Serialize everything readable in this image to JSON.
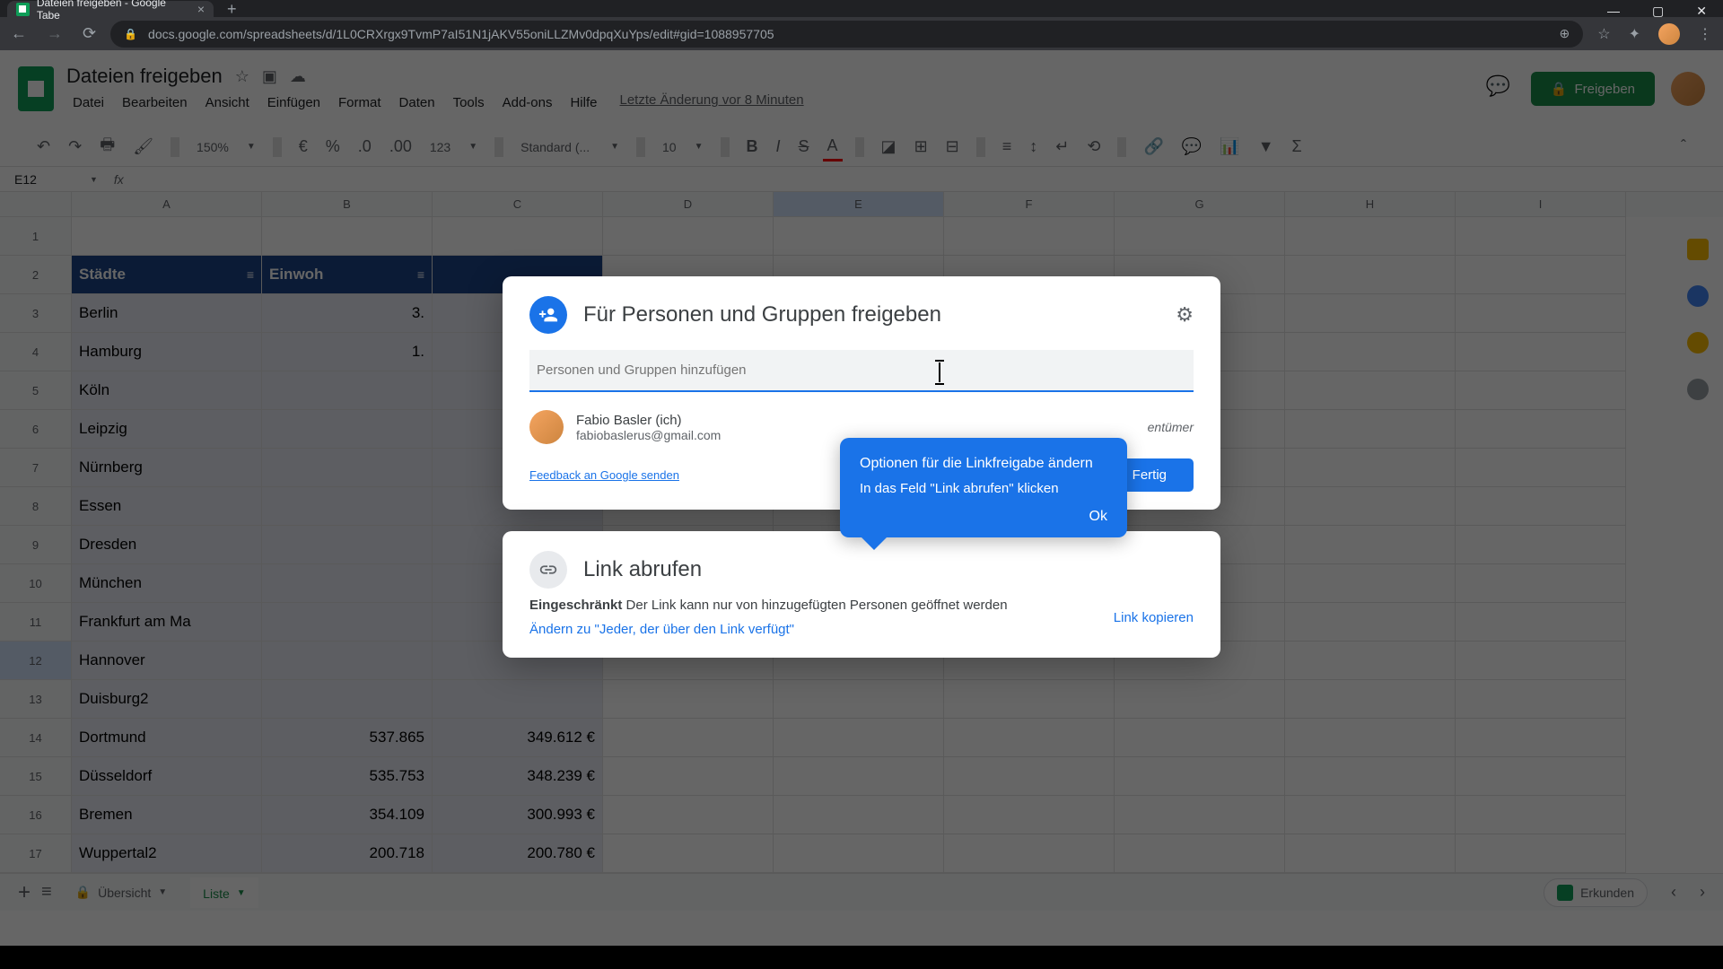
{
  "browser": {
    "tab_title": "Dateien freigeben - Google Tabe",
    "url": "docs.google.com/spreadsheets/d/1L0CRXrgx9TvmP7aI51N1jAKV55oniLLZMv0dpqXuYps/edit#gid=1088957705"
  },
  "app": {
    "title": "Dateien freigeben",
    "menus": [
      "Datei",
      "Bearbeiten",
      "Ansicht",
      "Einfügen",
      "Format",
      "Daten",
      "Tools",
      "Add-ons",
      "Hilfe"
    ],
    "last_change": "Letzte Änderung vor 8 Minuten",
    "share_button": "Freigeben",
    "zoom": "150%",
    "font": "Standard (...",
    "font_size": "10",
    "px_format": "123",
    "cell_ref": "E12"
  },
  "cols": [
    "A",
    "B",
    "C",
    "D",
    "E",
    "F",
    "G",
    "H",
    "I"
  ],
  "table": {
    "header": [
      "Städte",
      "Einwoh"
    ],
    "rows": [
      {
        "city": "Berlin",
        "pop": "3.",
        "val": ""
      },
      {
        "city": "Hamburg",
        "pop": "1.",
        "val": ""
      },
      {
        "city": "Köln",
        "pop": "",
        "val": ""
      },
      {
        "city": "Leipzig",
        "pop": "",
        "val": ""
      },
      {
        "city": "Nürnberg",
        "pop": "",
        "val": ""
      },
      {
        "city": "Essen",
        "pop": "",
        "val": ""
      },
      {
        "city": "Dresden",
        "pop": "",
        "val": ""
      },
      {
        "city": "München",
        "pop": "",
        "val": ""
      },
      {
        "city": "Frankfurt am Ma",
        "pop": "",
        "val": ""
      },
      {
        "city": "Hannover",
        "pop": "",
        "val": ""
      },
      {
        "city": "Duisburg2",
        "pop": "",
        "val": ""
      },
      {
        "city": "Dortmund",
        "pop": "537.865",
        "val": "349.612 €"
      },
      {
        "city": "Düsseldorf",
        "pop": "535.753",
        "val": "348.239 €"
      },
      {
        "city": "Bremen",
        "pop": "354.109",
        "val": "300.993 €"
      },
      {
        "city": "Wuppertal2",
        "pop": "200.718",
        "val": "200.780 €"
      }
    ]
  },
  "sheets": {
    "tab1": "Übersicht",
    "tab2": "Liste",
    "explore": "Erkunden"
  },
  "dialog": {
    "title": "Für Personen und Gruppen freigeben",
    "input_placeholder": "Personen und Gruppen hinzufügen",
    "person_name": "Fabio Basler (ich)",
    "person_email": "fabiobaslerus@gmail.com",
    "person_role": "entümer",
    "feedback": "Feedback an Google senden",
    "done": "Fertig"
  },
  "dialog2": {
    "title": "Link abrufen",
    "restricted": "Eingeschränkt",
    "description": "Der Link kann nur von hinzugefügten Personen geöffnet werden",
    "change": "Ändern zu \"Jeder, der über den Link verfügt\"",
    "copy": "Link kopieren"
  },
  "tooltip": {
    "title": "Optionen für die Linkfreigabe ändern",
    "body": "In das Feld \"Link abrufen\" klicken",
    "ok": "Ok"
  }
}
